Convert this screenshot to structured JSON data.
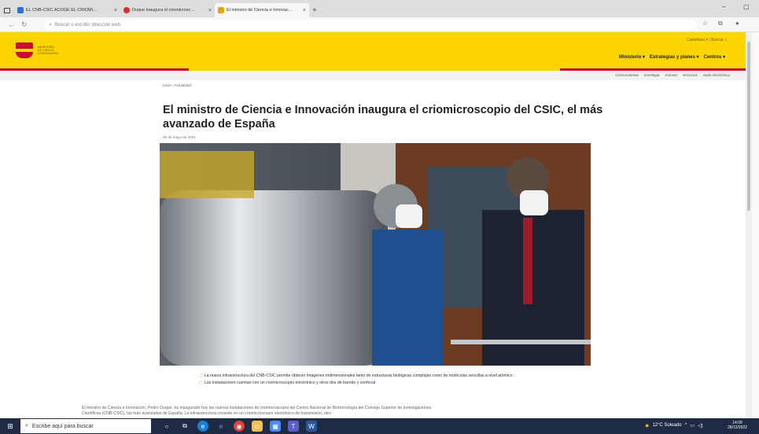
{
  "browser": {
    "tabs": [
      {
        "label": "EL CNB-CSIC ACOGE EL CRIOMI…",
        "color": "#2f6fd6"
      },
      {
        "label": "Duque inaugura el criomicrosc…",
        "color": "#d32f2f"
      },
      {
        "label": "El ministro de Ciencia e Innovac…",
        "color": "#e0a800"
      }
    ],
    "new_tab": "+",
    "close_tab": "×",
    "address_placeholder": "Buscar o escribir dirección web",
    "window_minimize": "–",
    "window_maximize": "▢"
  },
  "site": {
    "logo_lines": [
      "MINISTERIO",
      "DE CIENCIA",
      "E INNOVACIÓN"
    ],
    "top_links": {
      "lang": "Castellano ▾",
      "sep": "|",
      "search": "Buscar"
    },
    "nav": [
      "Ministerio ▾",
      "Estrategias y planes ▾",
      "Centros ▾"
    ],
    "subnav": [
      "Convocatorias",
      "Investigar",
      "Innovar",
      "Servicios",
      "Sede electrónica"
    ]
  },
  "article": {
    "breadcrumb": "Inicio › Actualidad",
    "title": "El ministro de Ciencia e Innovación inaugura el criomicroscopio del CSIC, el más avanzado de España",
    "date": "26 de mayo de 2021",
    "bullets": [
      "La nueva infraestructura del CNB-CSIC permite obtener imágenes tridimensionales tanto de estructuras biológicas complejas como de moléculas sencillas a nivel atómico",
      "Las instalaciones cuentan con un criomicroscopio electrónico y otros dos de barrido y confocal"
    ],
    "paragraph": "El ministro de Ciencia e Innovación, Pedro Duque, ha inaugurado hoy las nuevas instalaciones de criomicroscopía del Centro Nacional de Biotecnología del Consejo Superior de Investigaciones Científicas (CNB-CSIC), las más avanzadas de España. La infraestructura consiste en un criomicroscopio electrónico de transmisión, otro"
  },
  "taskbar": {
    "search_placeholder": "Escribe aquí para buscar",
    "weather": "12°C  Soleado",
    "time": "14:09",
    "date": "28/12/2022"
  },
  "colors": {
    "accent": "#ffd500",
    "red": "#c8102e",
    "taskbar": "#1f2a44"
  }
}
